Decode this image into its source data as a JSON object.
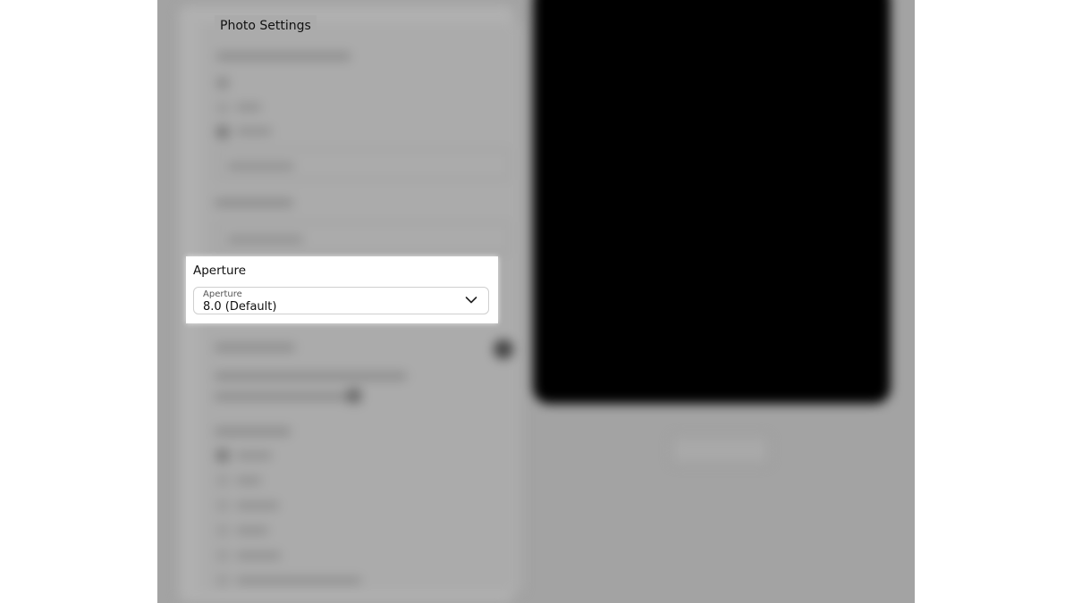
{
  "header": {
    "title": "Photo Settings"
  },
  "aperture": {
    "heading": "Aperture",
    "select_label": "Aperture",
    "selected_value": "8.0 (Default)",
    "icon": "chevron-down-icon"
  },
  "colors": {
    "dim_background": "#a3a3a3",
    "preview": "#000000",
    "highlight": "#ffffff"
  }
}
